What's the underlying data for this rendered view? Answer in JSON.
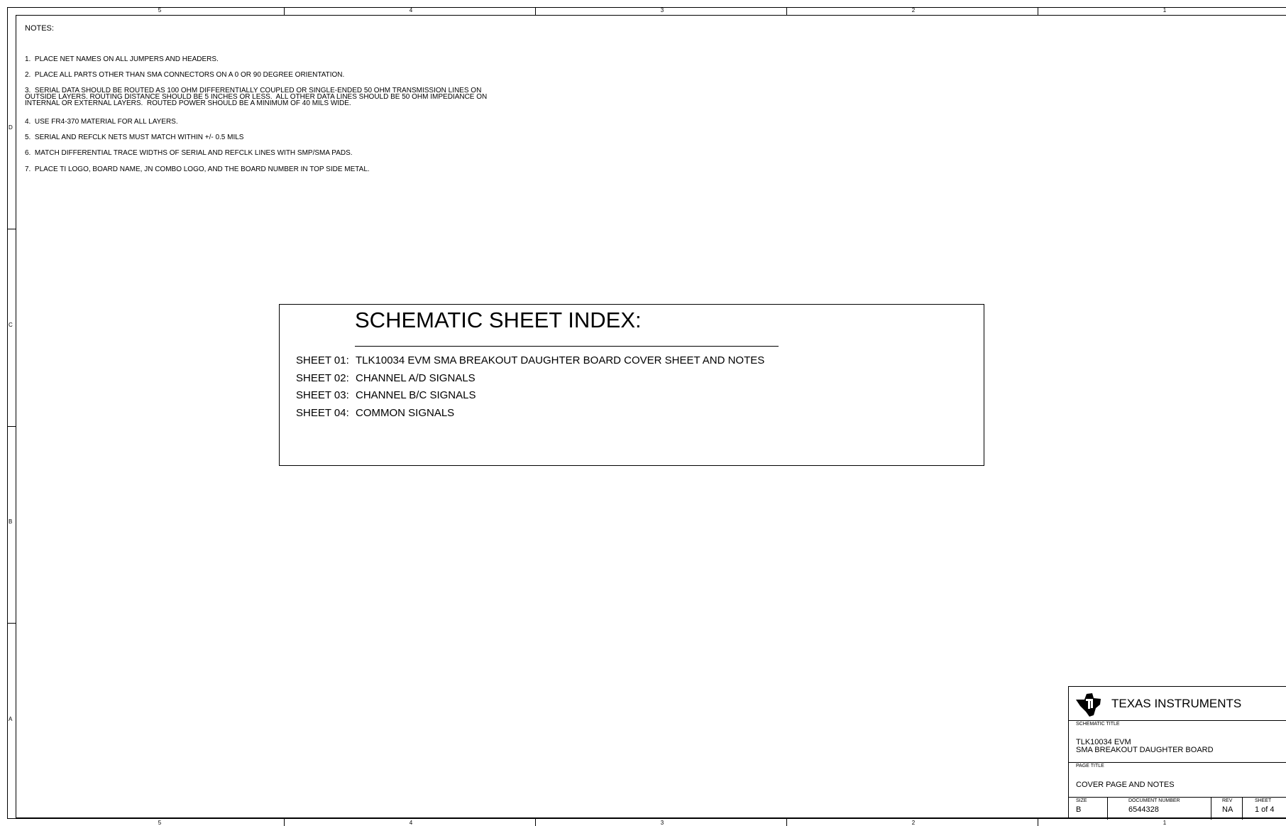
{
  "border": {
    "columns_top": [
      "5",
      "4",
      "3",
      "2",
      "1"
    ],
    "columns_bottom": [
      "5",
      "4",
      "3",
      "2",
      "1"
    ],
    "rows": [
      "D",
      "C",
      "B",
      "A"
    ]
  },
  "notes": {
    "title": "NOTES:",
    "items": [
      "1.  PLACE NET NAMES ON ALL JUMPERS AND HEADERS.",
      "2.  PLACE ALL PARTS OTHER THAN SMA CONNECTORS ON A 0 OR 90 DEGREE ORIENTATION.",
      "3.  SERIAL DATA SHOULD BE ROUTED AS 100 OHM DIFFERENTIALLY COUPLED OR SINGLE-ENDED 50 OHM TRANSMISSION LINES ON\nOUTSIDE LAYERS. ROUTING DISTANCE SHOULD BE 5 INCHES OR LESS.  ALL OTHER DATA LINES SHOULD BE 50 OHM IMPEDIANCE ON\nINTERNAL OR EXTERNAL LAYERS.  ROUTED POWER SHOULD BE A MINIMUM OF 40 MILS WIDE.",
      "4.  USE FR4-370 MATERIAL FOR ALL LAYERS.",
      "5.  SERIAL AND REFCLK NETS MUST MATCH WITHIN +/- 0.5 MILS",
      "6.  MATCH DIFFERENTIAL TRACE WIDTHS OF SERIAL AND REFCLK LINES WITH SMP/SMA PADS.",
      "7.  PLACE TI LOGO, BOARD NAME, JN COMBO LOGO, AND THE BOARD NUMBER IN TOP SIDE METAL."
    ]
  },
  "sheet_index": {
    "title": "SCHEMATIC SHEET INDEX:",
    "rows": [
      {
        "num": "SHEET 01:",
        "desc": "TLK10034 EVM SMA BREAKOUT DAUGHTER BOARD COVER SHEET AND NOTES"
      },
      {
        "num": "SHEET 02:",
        "desc": "CHANNEL A/D SIGNALS"
      },
      {
        "num": "SHEET 03:",
        "desc": "CHANNEL B/C SIGNALS"
      },
      {
        "num": "SHEET 04:",
        "desc": "COMMON SIGNALS"
      }
    ]
  },
  "title_block": {
    "company": "TEXAS INSTRUMENTS",
    "schematic_title_label": "SCHEMATIC TITLE",
    "schematic_title_line1": "TLK10034 EVM",
    "schematic_title_line2": "SMA BREAKOUT DAUGHTER BOARD",
    "page_title_label": "PAGE TITLE",
    "page_title": "COVER PAGE AND NOTES",
    "size_label": "SIZE",
    "size": "B",
    "doc_label": "DOCUMENT NUMBER",
    "doc_number": "6544328",
    "rev_label": "REV",
    "rev": "NA",
    "sheet_label": "SHEET",
    "sheet": "1 of 4"
  }
}
